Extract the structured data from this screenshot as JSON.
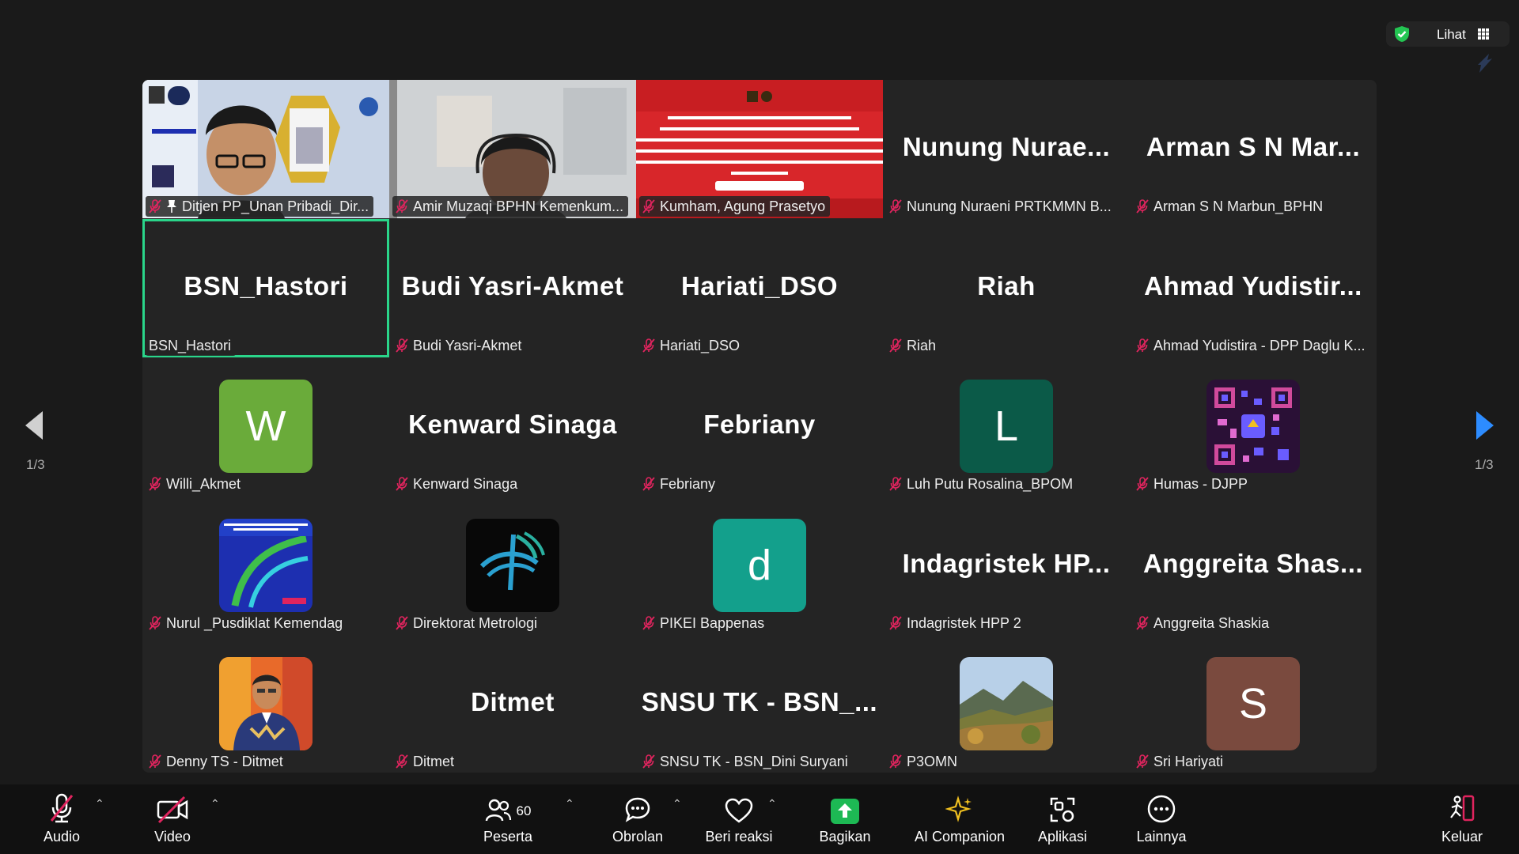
{
  "topbar": {
    "view_label": "Lihat"
  },
  "navigation": {
    "page_left": "1/3",
    "page_right": "1/3"
  },
  "tiles": [
    {
      "label": "Ditjen PP_Unan Pribadi_Dir...",
      "mode": "video",
      "muted": true,
      "pinned": true
    },
    {
      "label": "Amir Muzaqi BPHN Kemenkum...",
      "mode": "video",
      "muted": true
    },
    {
      "label": "Kumham, Agung Prasetyo",
      "mode": "video",
      "muted": true
    },
    {
      "big": "Nunung Nurae...",
      "label": "Nunung Nuraeni PRTKMMN B...",
      "mode": "name",
      "muted": true
    },
    {
      "big": "Arman S N Mar...",
      "label": "Arman S N Marbun_BPHN",
      "mode": "name",
      "muted": true
    },
    {
      "big": "BSN_Hastori",
      "label": "BSN_Hastori",
      "mode": "name",
      "muted": false,
      "active": true
    },
    {
      "big": "Budi Yasri-Akmet",
      "label": "Budi Yasri-Akmet",
      "mode": "name",
      "muted": true
    },
    {
      "big": "Hariati_DSO",
      "label": "Hariati_DSO",
      "mode": "name",
      "muted": true
    },
    {
      "big": "Riah",
      "label": "Riah",
      "mode": "name",
      "muted": true
    },
    {
      "big": "Ahmad Yudistir...",
      "label": "Ahmad Yudistira - DPP Daglu K...",
      "mode": "name",
      "muted": true
    },
    {
      "letter": "W",
      "label": "Willi_Akmet",
      "mode": "avatar",
      "color": "#6aab3a",
      "muted": true
    },
    {
      "big": "Kenward Sinaga",
      "label": "Kenward Sinaga",
      "mode": "name",
      "muted": true
    },
    {
      "big": "Febriany",
      "label": "Febriany",
      "mode": "name",
      "muted": true
    },
    {
      "letter": "L",
      "label": "Luh Putu Rosalina_BPOM",
      "mode": "avatar",
      "color": "#0b5a48",
      "muted": true
    },
    {
      "label": "Humas - DJPP",
      "mode": "avatar",
      "image": "qr",
      "muted": true
    },
    {
      "label": "Nurul _Pusdiklat Kemendag",
      "mode": "avatar",
      "image": "pusdiklat",
      "muted": true
    },
    {
      "label": "Direktorat Metrologi",
      "mode": "avatar",
      "image": "metrologi",
      "muted": true
    },
    {
      "letter": "d",
      "label": "PIKEI Bappenas",
      "mode": "avatar",
      "color": "#13a08c",
      "muted": true
    },
    {
      "big": "Indagristek HP...",
      "label": "Indagristek HPP 2",
      "mode": "name",
      "muted": true
    },
    {
      "big": "Anggreita Shas...",
      "label": "Anggreita Shaskia",
      "mode": "name",
      "muted": true
    },
    {
      "label": "Denny TS - Ditmet",
      "mode": "avatar",
      "image": "person",
      "muted": true
    },
    {
      "big": "Ditmet",
      "label": "Ditmet",
      "mode": "name",
      "muted": true
    },
    {
      "big": "SNSU TK - BSN_...",
      "label": "SNSU TK - BSN_Dini Suryani",
      "mode": "name",
      "muted": true
    },
    {
      "label": "P3OMN",
      "mode": "avatar",
      "image": "landscape",
      "muted": true
    },
    {
      "letter": "S",
      "label": "Sri Hariyati",
      "mode": "avatar",
      "color": "#7a4a3e",
      "muted": true
    }
  ],
  "toolbar": {
    "audio": "Audio",
    "video": "Video",
    "participants": "Peserta",
    "participants_count": "60",
    "chat": "Obrolan",
    "reactions": "Beri reaksi",
    "share": "Bagikan",
    "ai": "AI Companion",
    "apps": "Aplikasi",
    "more": "Lainnya",
    "leave": "Keluar"
  },
  "colors": {
    "active_border": "#2ad58a",
    "mute_red": "#e0245e",
    "share_green": "#1db954",
    "nav_blue": "#2d8cff"
  }
}
